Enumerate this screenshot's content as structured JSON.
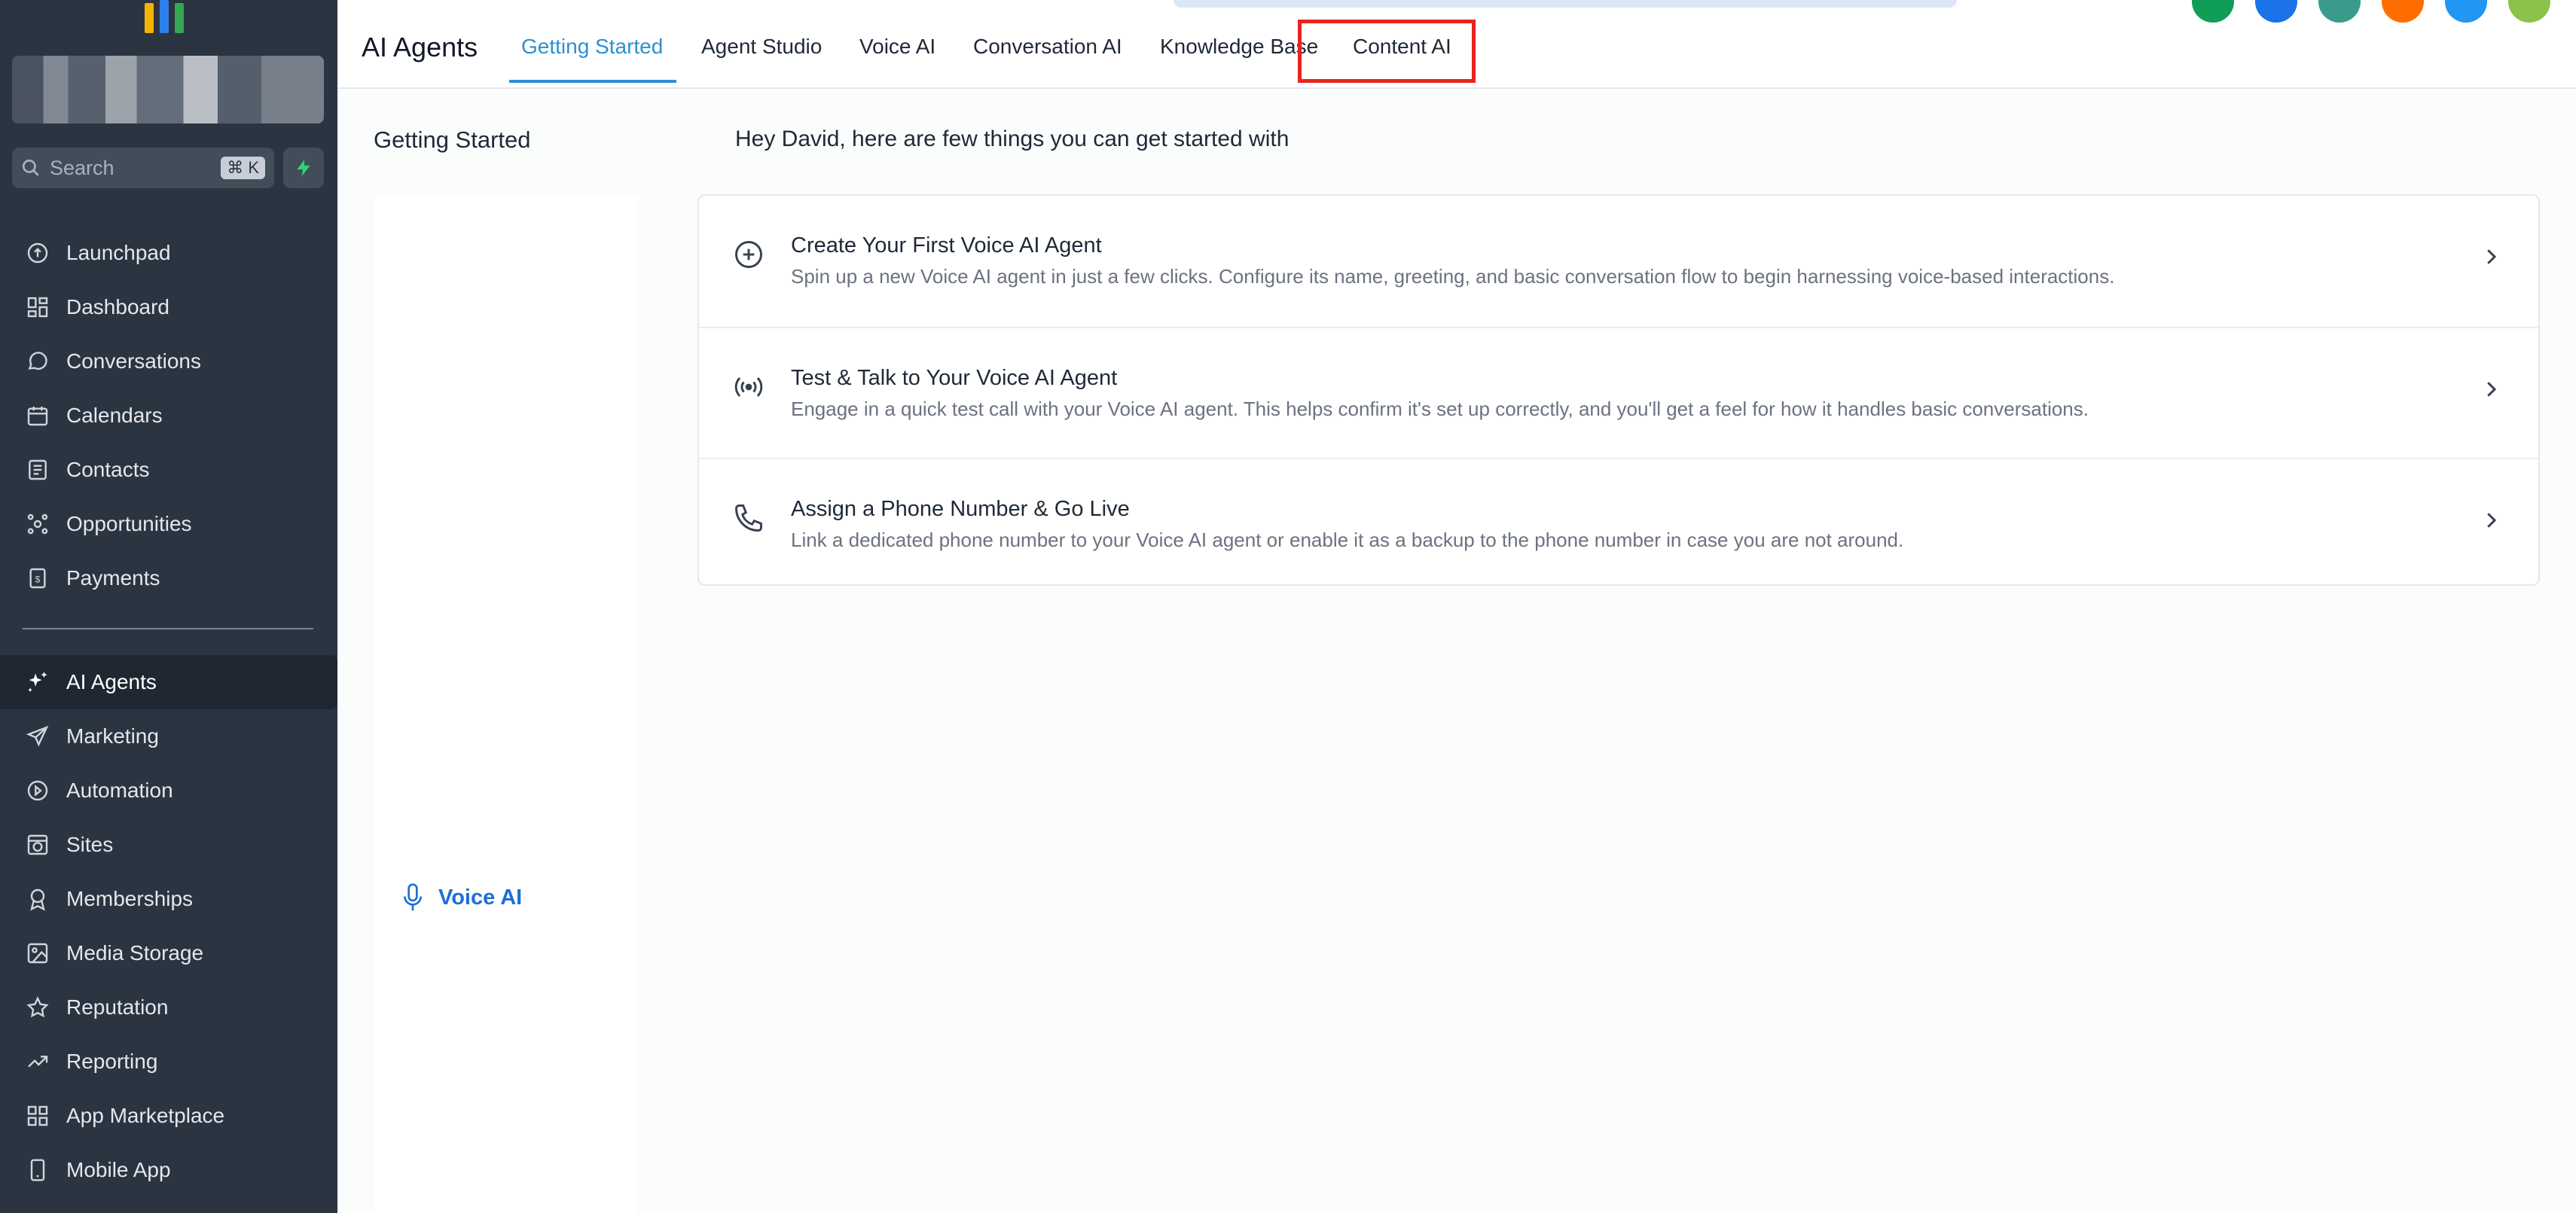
{
  "sidebar": {
    "search_placeholder": "Search",
    "search_shortcut": "⌘ K",
    "items": [
      {
        "label": "Launchpad",
        "icon": "launchpad-icon"
      },
      {
        "label": "Dashboard",
        "icon": "dashboard-icon"
      },
      {
        "label": "Conversations",
        "icon": "chat-bubble-icon"
      },
      {
        "label": "Calendars",
        "icon": "calendar-icon"
      },
      {
        "label": "Contacts",
        "icon": "contacts-icon"
      },
      {
        "label": "Opportunities",
        "icon": "opportunities-icon"
      },
      {
        "label": "Payments",
        "icon": "payments-icon"
      }
    ],
    "items2": [
      {
        "label": "AI Agents",
        "icon": "sparkle-icon",
        "active": true
      },
      {
        "label": "Marketing",
        "icon": "send-icon"
      },
      {
        "label": "Automation",
        "icon": "automation-icon"
      },
      {
        "label": "Sites",
        "icon": "globe-icon"
      },
      {
        "label": "Memberships",
        "icon": "award-icon"
      },
      {
        "label": "Media Storage",
        "icon": "image-icon"
      },
      {
        "label": "Reputation",
        "icon": "star-icon"
      },
      {
        "label": "Reporting",
        "icon": "trend-icon"
      },
      {
        "label": "App Marketplace",
        "icon": "grid-icon"
      },
      {
        "label": "Mobile App",
        "icon": "phone-device-icon"
      }
    ]
  },
  "header": {
    "title": "AI Agents",
    "tabs": [
      {
        "label": "Getting Started",
        "active": true
      },
      {
        "label": "Agent Studio"
      },
      {
        "label": "Voice AI"
      },
      {
        "label": "Conversation AI",
        "highlighted": true
      },
      {
        "label": "Knowledge Base"
      },
      {
        "label": "Content AI"
      }
    ],
    "avatar_colors": [
      "#0f9d58",
      "#1a73e8",
      "#3a9b8a",
      "#ff6d00",
      "#2196f3",
      "#8bc34a"
    ]
  },
  "main": {
    "side_heading": "Getting Started",
    "side_link": "Voice AI",
    "greeting": "Hey David, here are few things you can get started with",
    "cards": [
      {
        "title": "Create Your First Voice AI Agent",
        "description": "Spin up a new Voice AI agent in just a few clicks. Configure its name, greeting, and basic conversation flow to begin harnessing voice-based interactions.",
        "icon": "plus-circle-icon"
      },
      {
        "title": "Test & Talk to Your Voice AI Agent",
        "description": "Engage in a quick test call with your Voice AI agent. This helps confirm it's set up correctly, and you'll get a feel for how it handles basic conversations.",
        "icon": "broadcast-icon"
      },
      {
        "title": "Assign a Phone Number & Go Live",
        "description": "Link a dedicated phone number to your Voice AI agent or enable it as a backup to the phone number in case you are not around.",
        "icon": "phone-icon"
      }
    ]
  },
  "colors": {
    "sidebar_bg": "#2b3441",
    "accent": "#2f8fd1",
    "highlight": "#e8241c",
    "link": "#1d6fd6"
  }
}
